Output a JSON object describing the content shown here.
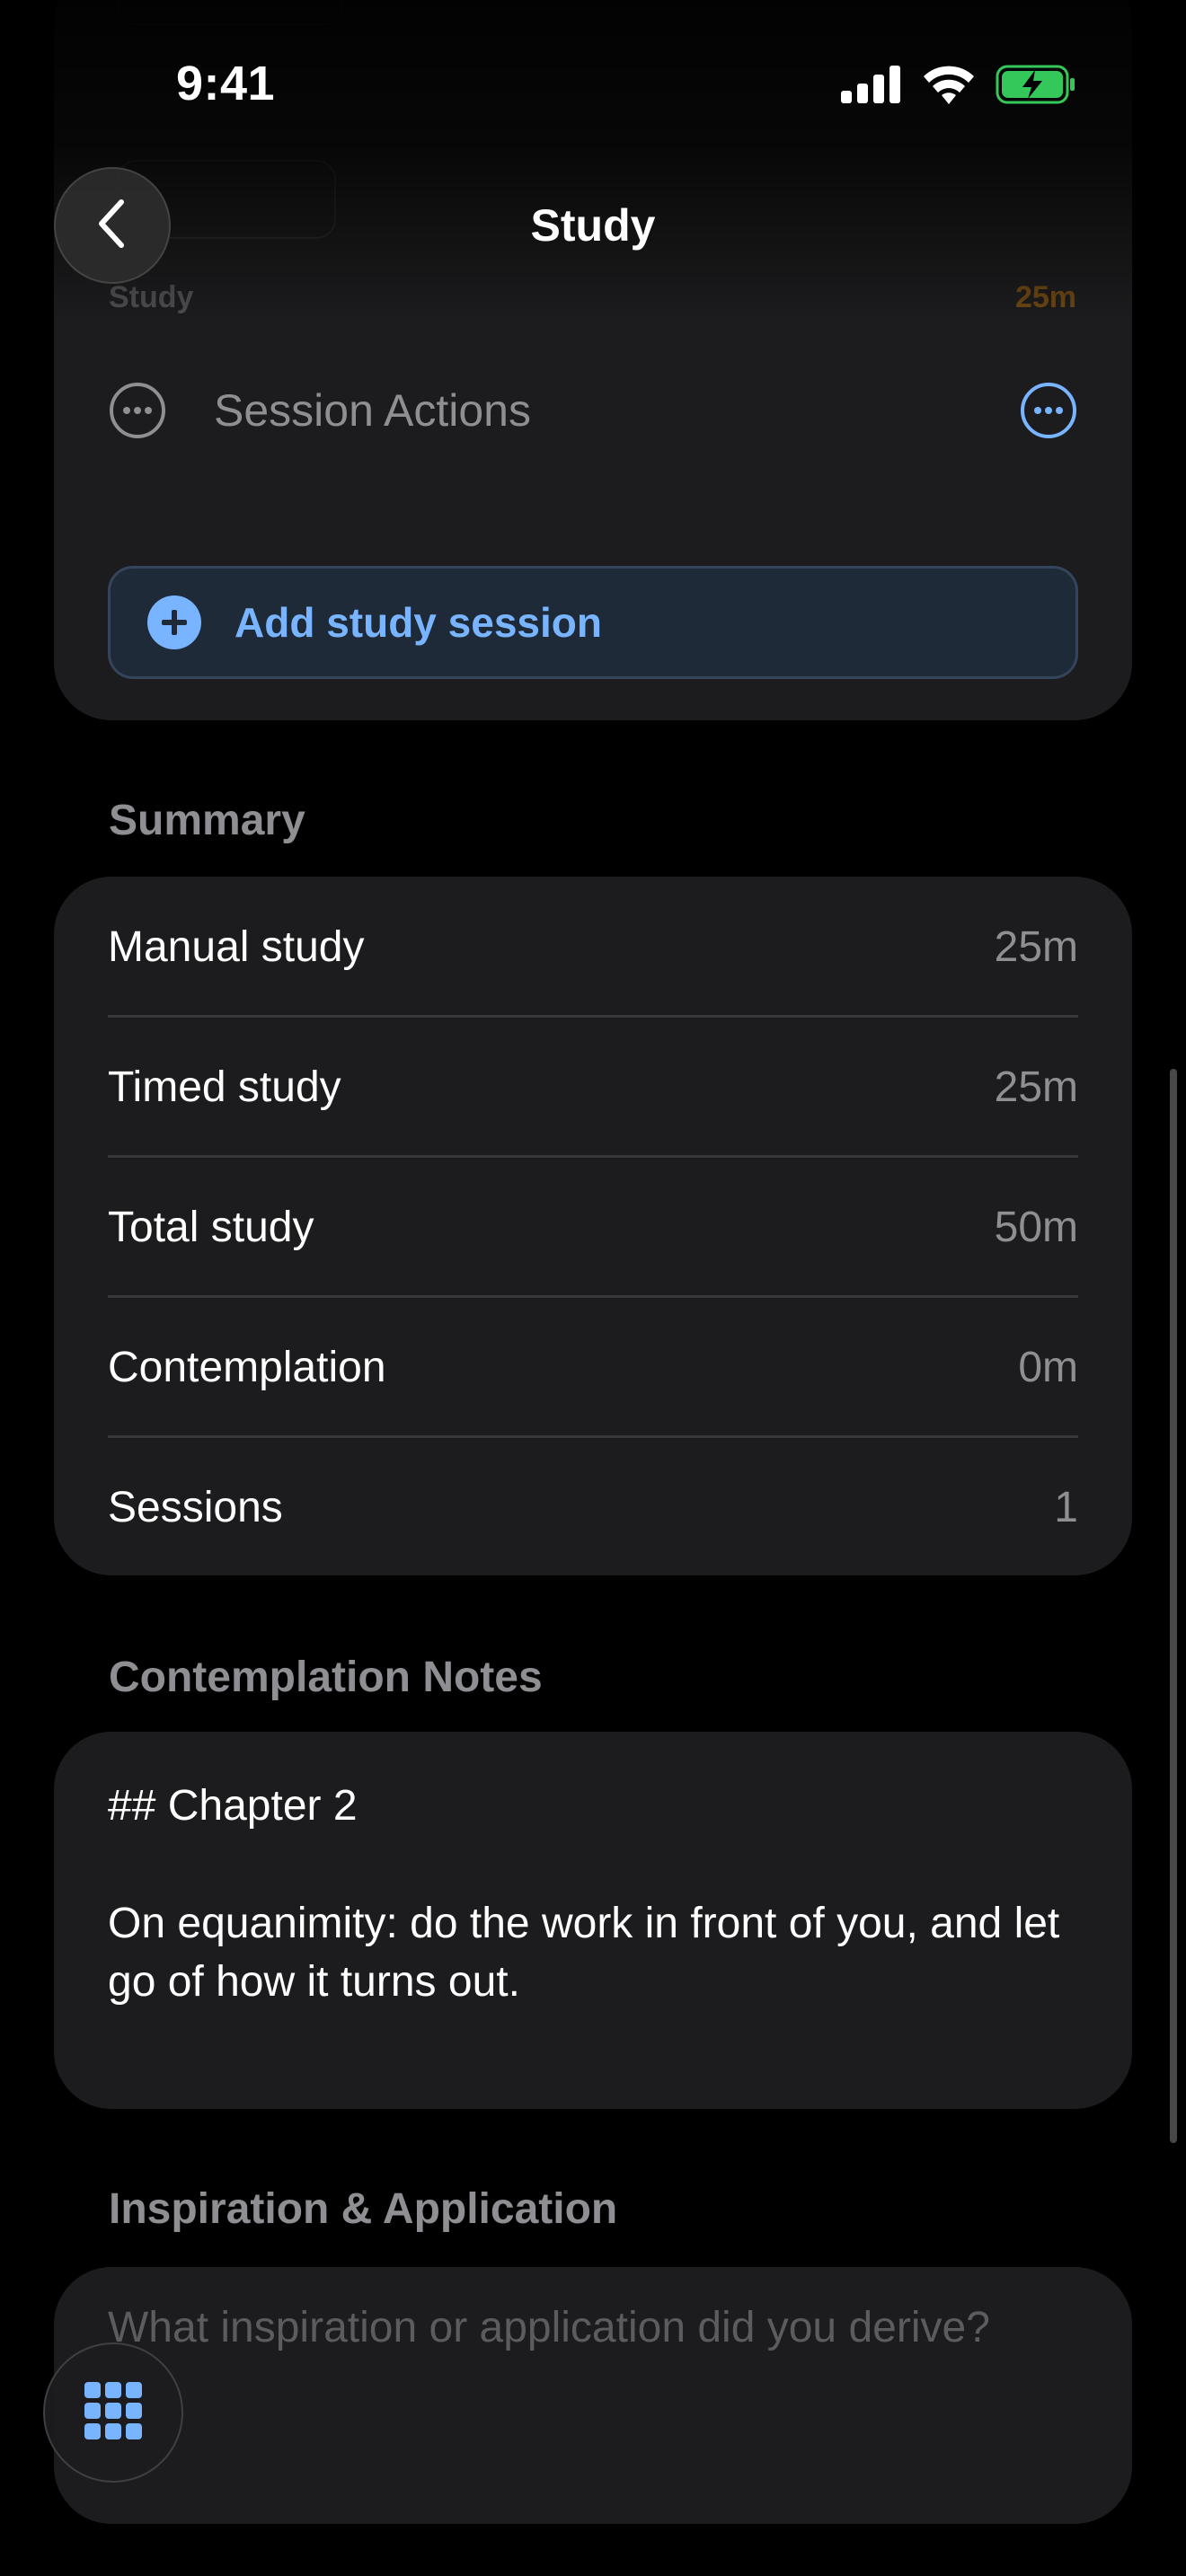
{
  "status_bar": {
    "time": "9:41",
    "icons": [
      "signal-icon",
      "wifi-icon",
      "battery-charging-icon"
    ]
  },
  "nav": {
    "title": "Study",
    "back_icon": "chevron-left-icon"
  },
  "session": {
    "type_label": "Study",
    "duration": "25m",
    "actions_label": "Session Actions",
    "add_button_label": "Add study session"
  },
  "summary": {
    "header": "Summary",
    "rows": [
      {
        "label": "Manual study",
        "value": "25m"
      },
      {
        "label": "Timed study",
        "value": "25m"
      },
      {
        "label": "Total study",
        "value": "50m"
      },
      {
        "label": "Contemplation",
        "value": "0m"
      },
      {
        "label": "Sessions",
        "value": "1"
      }
    ]
  },
  "notes": {
    "header": "Contemplation Notes",
    "heading_line": "## Chapter 2",
    "body": "On equanimity: do the work in front of you, and let go of how it turns out."
  },
  "inspiration": {
    "header": "Inspiration & Application",
    "placeholder": "What inspiration or application did you derive?"
  },
  "colors": {
    "accent": "#78b4ff",
    "card": "#1c1c1e",
    "secondary_text": "#8e8e93",
    "battery": "#34c759",
    "duration_orange": "#ff9500"
  }
}
